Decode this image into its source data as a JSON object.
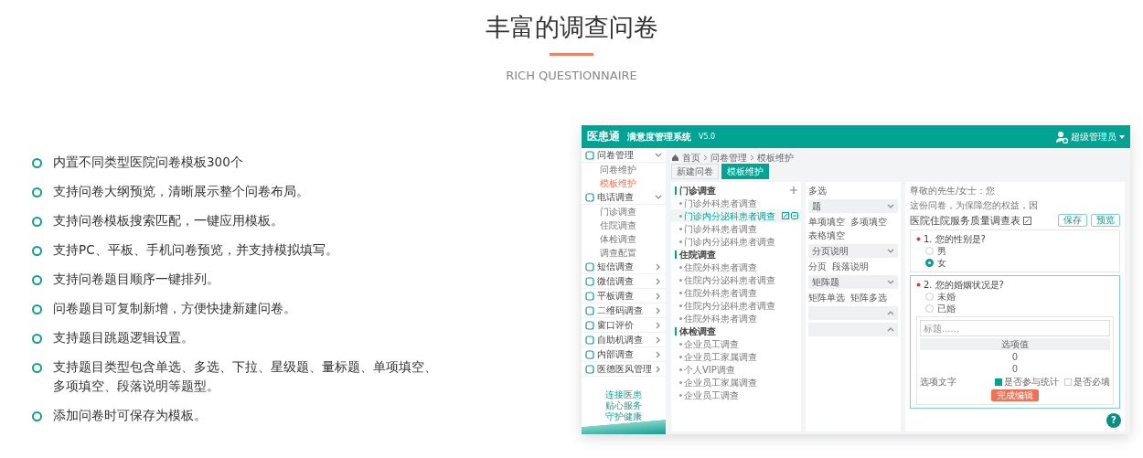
{
  "heading": {
    "title": "丰富的调查问卷",
    "subtitle": "RICH QUESTIONNAIRE"
  },
  "features": [
    "内置不同类型医院问卷模板300个",
    "支持问卷大纲预览，清晰展示整个问卷布局。",
    "支持问卷模板搜索匹配，一键应用模板。",
    "支持PC、平板、手机问卷预览，并支持模拟填写。",
    "支持问卷题目顺序一键排列。",
    "问卷题目可复制新增，方便快捷新建问卷。",
    "支持题目跳题逻辑设置。",
    "支持题目类型包含单选、多选、下拉、星级题、量标题、单项填空、多项填空、段落说明等题型。",
    "添加问卷时可保存为模板。"
  ],
  "app": {
    "logo": "医患通",
    "system_name": "满意度管理系统",
    "version": "V5.0",
    "user": "超级管理员",
    "sidebar": [
      {
        "label": "问卷管理",
        "expanded": true,
        "children": [
          {
            "label": "问卷维护",
            "selected": false
          },
          {
            "label": "模板维护",
            "selected": true
          }
        ]
      },
      {
        "label": "电话调查",
        "expanded": true,
        "children": [
          {
            "label": "门诊调查",
            "selected": false
          },
          {
            "label": "住院调查",
            "selected": false
          },
          {
            "label": "体检调查",
            "selected": false
          },
          {
            "label": "调查配置",
            "selected": false
          }
        ]
      },
      {
        "label": "短信调查",
        "expanded": false
      },
      {
        "label": "微信调查",
        "expanded": false
      },
      {
        "label": "平板调查",
        "expanded": false
      },
      {
        "label": "二维码调查",
        "expanded": false
      },
      {
        "label": "窗口评价",
        "expanded": false
      },
      {
        "label": "自助机调查",
        "expanded": false
      },
      {
        "label": "内部调查",
        "expanded": false
      },
      {
        "label": "医德医风管理",
        "expanded": false
      }
    ],
    "slogan": [
      "连接医患",
      "贴心服务",
      "守护健康"
    ],
    "breadcrumb": [
      "首页",
      "问卷管理",
      "模板维护"
    ],
    "tabs": [
      {
        "label": "新建问卷",
        "selected": false
      },
      {
        "label": "模板维护",
        "selected": true
      }
    ],
    "template_groups": [
      {
        "title": "门诊调查",
        "items": [
          {
            "label": "门诊外科患者调查",
            "selected": false
          },
          {
            "label": "门诊内分泌科患者调查",
            "selected": true
          },
          {
            "label": "门诊外科患者调查",
            "selected": false
          },
          {
            "label": "门诊内分泌科患者调查",
            "selected": false
          }
        ]
      },
      {
        "title": "住院调查",
        "items": [
          {
            "label": "住院外科患者调查",
            "selected": false
          },
          {
            "label": "住院内分泌科患者调查",
            "selected": false
          },
          {
            "label": "住院外科患者调查",
            "selected": false
          },
          {
            "label": "住院内分泌科患者调查",
            "selected": false
          },
          {
            "label": "住院外科患者调查",
            "selected": false
          }
        ]
      },
      {
        "title": "体检调查",
        "items": [
          {
            "label": "企业员工调查",
            "selected": false
          },
          {
            "label": "企业员工家属调查",
            "selected": false
          },
          {
            "label": "个人VIP调查",
            "selected": false
          },
          {
            "label": "企业员工家属调查",
            "selected": false
          },
          {
            "label": "企业员工调查",
            "selected": false
          }
        ]
      }
    ],
    "components": [
      {
        "kind": "options",
        "items": [
          "多选"
        ]
      },
      {
        "kind": "header",
        "label": "题",
        "expanded": true
      },
      {
        "kind": "options",
        "items": [
          "单项填空",
          "多项填空",
          "表格填空"
        ]
      },
      {
        "kind": "header",
        "label": "分页说明",
        "expanded": true
      },
      {
        "kind": "options",
        "items": [
          "分页",
          "段落说明"
        ]
      },
      {
        "kind": "header",
        "label": "矩阵题",
        "expanded": true
      },
      {
        "kind": "options",
        "items": [
          "矩阵单选",
          "矩阵多选"
        ]
      },
      {
        "kind": "header",
        "expanded": false
      },
      {
        "kind": "header",
        "expanded": false
      }
    ],
    "editor": {
      "intro": [
        "尊敬的先生/女士：您",
        "这份问卷，为保障您的权益，因"
      ],
      "title": "医院住院服务质量调查表",
      "buttons": [
        "保存",
        "预览"
      ],
      "questions": [
        {
          "number": "1.",
          "text": "您的性别是?",
          "required": true,
          "editing": false,
          "options": [
            {
              "label": "男",
              "selected": false
            },
            {
              "label": "女",
              "selected": true
            }
          ]
        },
        {
          "number": "2.",
          "text": "您的婚姻状况是?",
          "required": true,
          "editing": true,
          "options": [
            {
              "label": "未婚",
              "selected": false
            },
            {
              "label": "已婚",
              "selected": false
            }
          ]
        }
      ],
      "edit_box": {
        "placeholder": "标题......",
        "column": "选项值",
        "values": [
          "0",
          "0"
        ],
        "option_label": "选项文字",
        "checks": [
          {
            "label": "是否参与统计",
            "checked": true
          },
          {
            "label": "是否必填",
            "checked": false
          }
        ],
        "done": "完成编辑"
      }
    },
    "help": "?"
  }
}
